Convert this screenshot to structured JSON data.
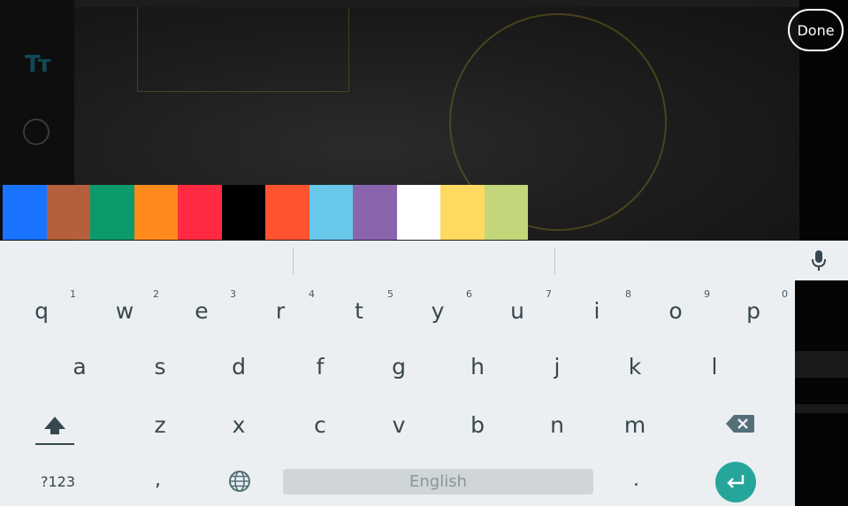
{
  "toolbar": {
    "text_tool_label": "Tт",
    "done_label": "Done"
  },
  "palette": {
    "colors": [
      "#1a73ff",
      "#b4603c",
      "#0c9a6c",
      "#ff8a1c",
      "#ff2a41",
      "#000000",
      "#ff5330",
      "#67c8ea",
      "#8a65ae",
      "#ffffff",
      "#fedb60",
      "#c4d67a"
    ]
  },
  "keyboard": {
    "row1": [
      {
        "key": "q",
        "hint": "1"
      },
      {
        "key": "w",
        "hint": "2"
      },
      {
        "key": "e",
        "hint": "3"
      },
      {
        "key": "r",
        "hint": "4"
      },
      {
        "key": "t",
        "hint": "5"
      },
      {
        "key": "y",
        "hint": "6"
      },
      {
        "key": "u",
        "hint": "7"
      },
      {
        "key": "i",
        "hint": "8"
      },
      {
        "key": "o",
        "hint": "9"
      },
      {
        "key": "p",
        "hint": "0"
      }
    ],
    "row2": [
      "a",
      "s",
      "d",
      "f",
      "g",
      "h",
      "j",
      "k",
      "l"
    ],
    "row3": [
      "z",
      "x",
      "c",
      "v",
      "b",
      "n",
      "m"
    ],
    "symbols_label": "?123",
    "comma_label": ",",
    "space_label": "English",
    "period_label": ".",
    "accent_color": "#26a69a",
    "icons": [
      "mic-icon",
      "shift-icon",
      "backspace-icon",
      "globe-icon",
      "enter-icon"
    ]
  }
}
